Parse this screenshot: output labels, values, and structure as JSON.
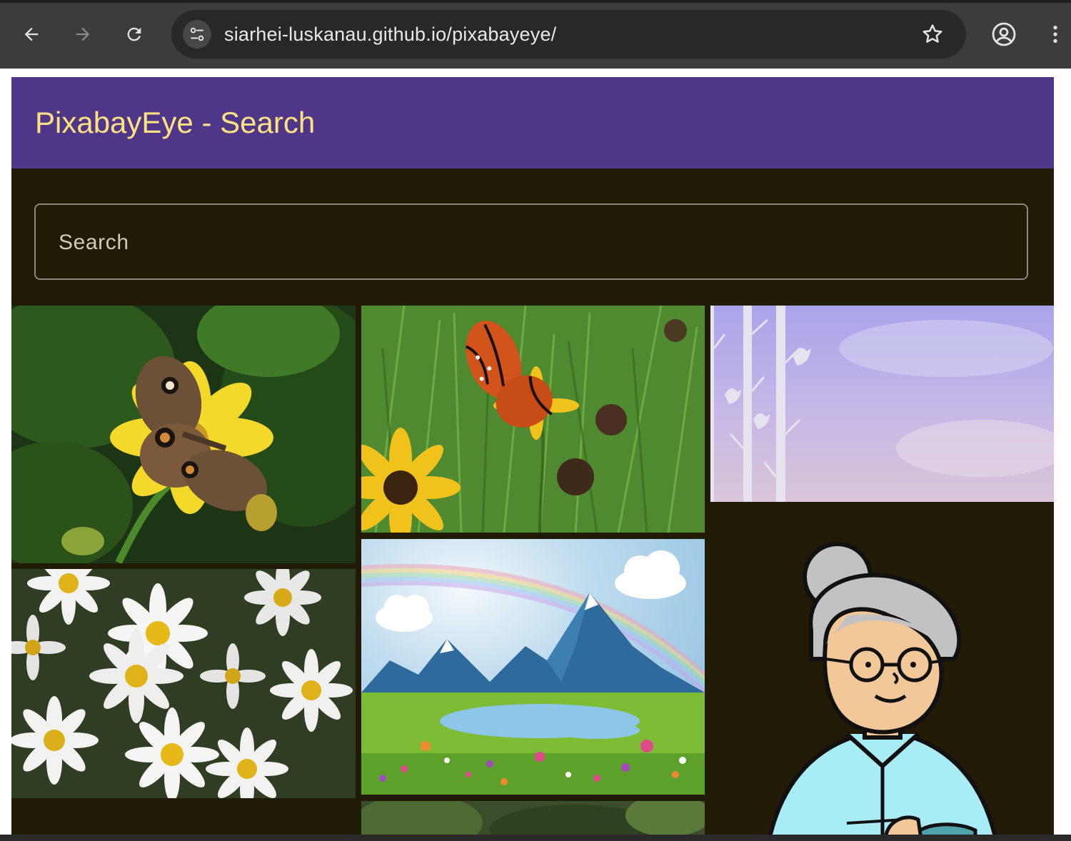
{
  "browser": {
    "url": "siarhei-luskanau.github.io/pixabayeye/",
    "back_icon": "arrow-left-icon",
    "forward_icon": "arrow-right-icon",
    "reload_icon": "reload-icon",
    "site_info_icon": "tune-icon",
    "bookmark_icon": "star-icon",
    "profile_icon": "account-circle-icon",
    "menu_icon": "more-vert-icon"
  },
  "app": {
    "title": "PixabayEye - Search",
    "colors": {
      "appbar": "#4e3789",
      "title": "#ffe082",
      "background": "#211b06",
      "search_border": "#8c8778"
    }
  },
  "search": {
    "placeholder": "Search",
    "value": ""
  },
  "gallery": {
    "images": [
      {
        "subject": "butterfly on yellow flower"
      },
      {
        "subject": "orange butterfly on sunflower in grass"
      },
      {
        "subject": "birds on birch trees against purple sky"
      },
      {
        "subject": "white daisies"
      },
      {
        "subject": "mountains rainbow lake meadow illustration"
      },
      {
        "subject": "grandmother with glasses cartoon"
      },
      {
        "subject": "green foliage"
      }
    ]
  }
}
